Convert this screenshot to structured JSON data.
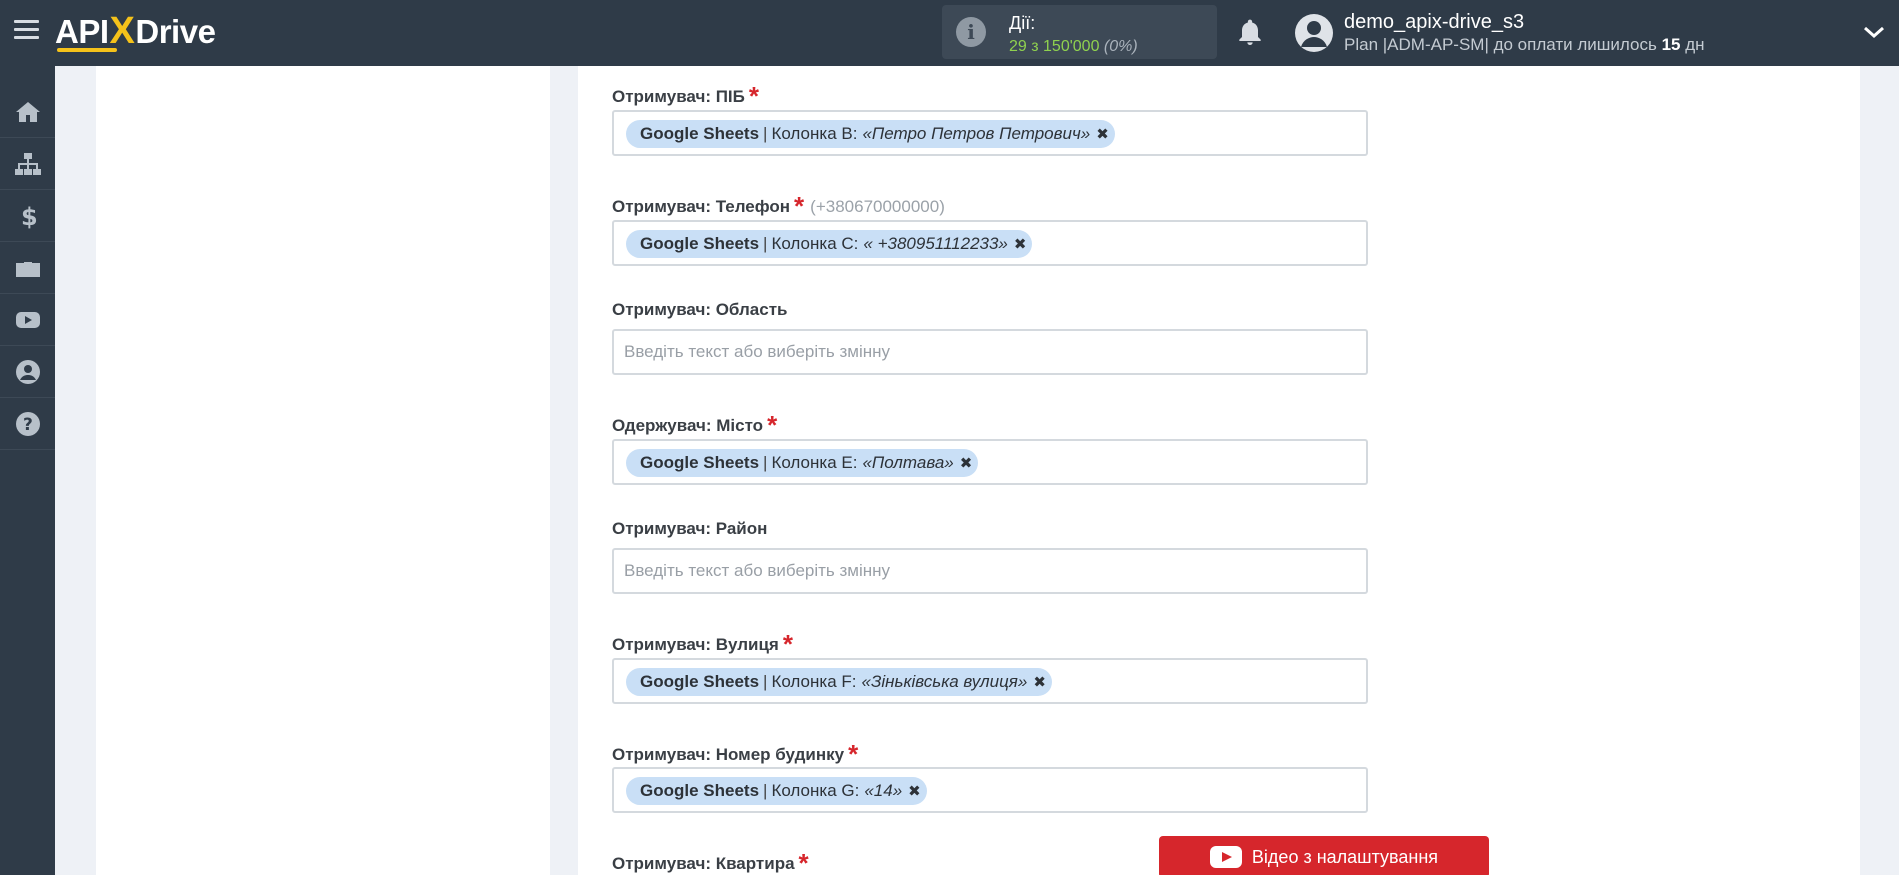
{
  "header": {
    "logo_text_left": "API",
    "logo_text_x": "X",
    "logo_text_right": "Drive",
    "actions_label": "Дії:",
    "actions_count": "29 з 150'000",
    "actions_percent": "(0%)",
    "username": "demo_apix-drive_s3",
    "plan_text": "Plan |ADM-AP-SM| до оплати лишилось",
    "plan_days": "15",
    "plan_days_unit": "дн"
  },
  "sidebar": {
    "items": [
      {
        "icon": "home-icon"
      },
      {
        "icon": "sitemap-icon"
      },
      {
        "icon": "dollar-icon"
      },
      {
        "icon": "briefcase-icon"
      },
      {
        "icon": "youtube-icon"
      },
      {
        "icon": "user-icon"
      },
      {
        "icon": "help-icon"
      }
    ]
  },
  "form": {
    "fields": [
      {
        "label": "Отримувач: ПІБ",
        "required": "*",
        "source": "Google Sheets",
        "sep": "|",
        "column": "Колонка B:",
        "value": "«Петро Петров Петрович»"
      },
      {
        "label": "Отримувач: Телефон",
        "required": "*",
        "hint": "(+380670000000)",
        "source": "Google Sheets",
        "sep": "|",
        "column": "Колонка C:",
        "value": "« +380951112233»"
      },
      {
        "label": "Отримувач: Область",
        "placeholder": "Введіть текст або виберіть змінну"
      },
      {
        "label": "Одержувач: Місто",
        "required": "*",
        "source": "Google Sheets",
        "sep": "|",
        "column": "Колонка E:",
        "value": "«Полтава»"
      },
      {
        "label": "Отримувач: Район",
        "placeholder": "Введіть текст або виберіть змінну"
      },
      {
        "label": "Отримувач: Вулиця",
        "required": "*",
        "source": "Google Sheets",
        "sep": "|",
        "column": "Колонка F:",
        "value": "«Зіньківська вулиця»"
      },
      {
        "label": "Отримувач: Номер будинку",
        "required": "*",
        "source": "Google Sheets",
        "sep": "|",
        "column": "Колонка G:",
        "value": "«14»"
      },
      {
        "label": "Отримувач: Квартира",
        "required": "*"
      }
    ],
    "remove_glyph": "✖"
  },
  "video_button": {
    "label": "Відео з налаштування"
  },
  "colors": {
    "accent_red": "#d6262c",
    "tag_bg": "#c9dff6",
    "topbar": "#2f3b48",
    "count_green": "#8fd14f"
  }
}
